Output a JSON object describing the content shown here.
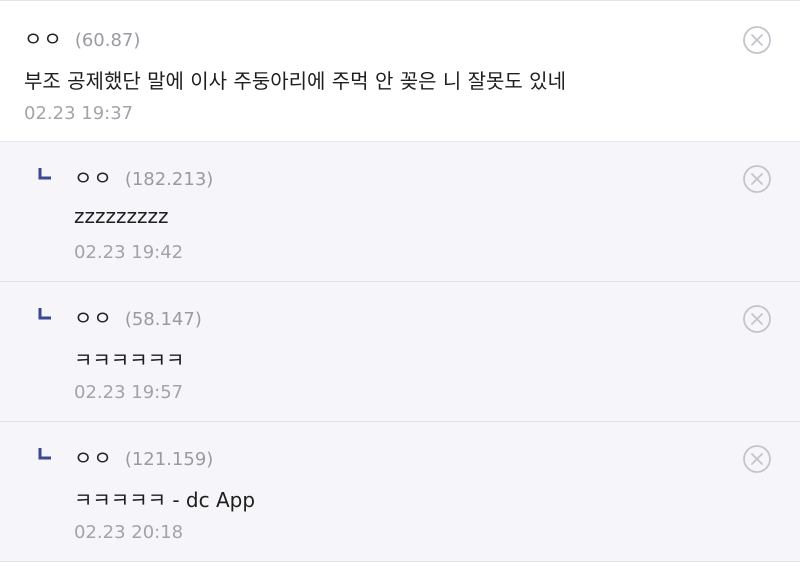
{
  "main_comment": {
    "nickname": "ㅇㅇ",
    "ip": "(60.87)",
    "text": "부조 공제했단 말에 이사 주둥아리에 주먹 안 꽂은 니 잘못도 있네",
    "date": "02.23 19:37"
  },
  "replies": [
    {
      "nickname": "ㅇㅇ",
      "ip": "(182.213)",
      "text": "zzzzzzzzz",
      "date": "02.23 19:42"
    },
    {
      "nickname": "ㅇㅇ",
      "ip": "(58.147)",
      "text": "ㅋㅋㅋㅋㅋㅋ",
      "date": "02.23 19:57"
    },
    {
      "nickname": "ㅇㅇ",
      "ip": "(121.159)",
      "text": "ㅋㅋㅋㅋㅋ - dc App",
      "date": "02.23 20:18"
    }
  ],
  "icons": {
    "reply_arrow": "reply-arrow-icon",
    "delete": "delete-circle-x-icon"
  },
  "colors": {
    "reply_background": "#f5f5fa",
    "reply_arrow": "#3b4890",
    "meta_text": "#9a9aa2",
    "delete_icon": "#c4c4cc"
  }
}
